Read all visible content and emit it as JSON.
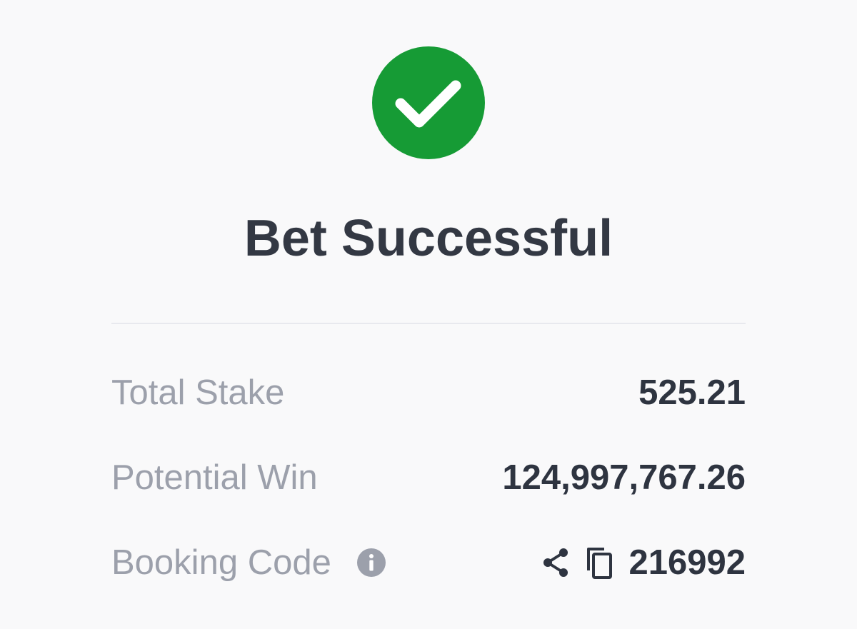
{
  "status": {
    "icon": "check-icon",
    "color": "#169b35",
    "title": "Bet Successful"
  },
  "details": {
    "total_stake": {
      "label": "Total Stake",
      "value": "525.21"
    },
    "potential_win": {
      "label": "Potential Win",
      "value": "124,997,767.26"
    },
    "booking_code": {
      "label": "Booking Code",
      "value": "216992",
      "info_icon": "info-icon",
      "share_icon": "share-icon",
      "copy_icon": "copy-icon"
    }
  }
}
